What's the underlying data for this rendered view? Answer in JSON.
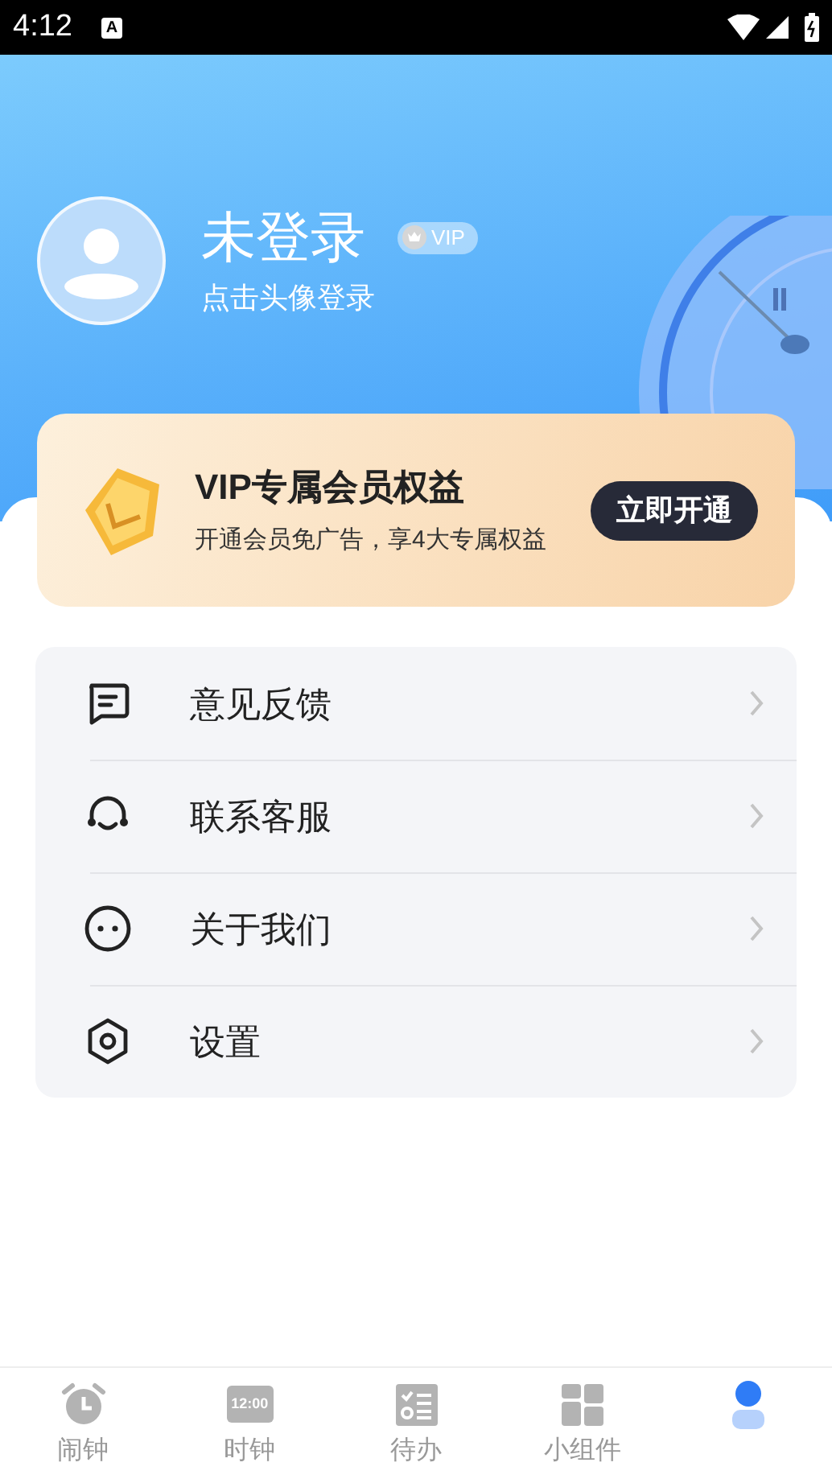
{
  "status_bar": {
    "time": "4:12",
    "notification": "A"
  },
  "profile": {
    "name": "未登录",
    "badge": "VIP",
    "hint": "点击头像登录"
  },
  "vip_card": {
    "title": "VIP专属会员权益",
    "subtitle": "开通会员免广告，享4大专属权益",
    "button": "立即开通"
  },
  "menu": [
    {
      "kind": "feedback",
      "label": "意见反馈"
    },
    {
      "kind": "service",
      "label": "联系客服"
    },
    {
      "kind": "about",
      "label": "关于我们"
    },
    {
      "kind": "settings",
      "label": "设置"
    }
  ],
  "tabs": [
    {
      "kind": "alarm",
      "label": "闹钟",
      "selected": false
    },
    {
      "kind": "clock",
      "label": "时钟",
      "icon_text": "12:00",
      "selected": false
    },
    {
      "kind": "todo",
      "label": "待办",
      "selected": false
    },
    {
      "kind": "widget",
      "label": "小组件",
      "selected": false
    },
    {
      "kind": "mine",
      "selected": true
    }
  ]
}
